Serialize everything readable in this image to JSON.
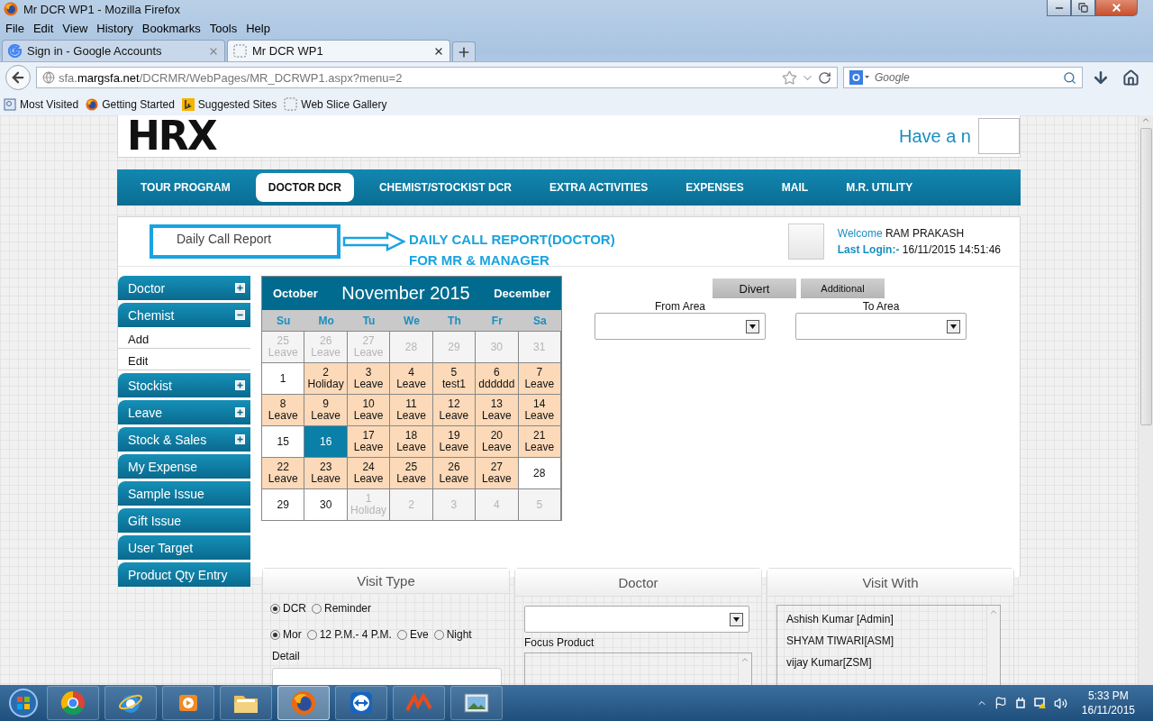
{
  "browser": {
    "title": "Mr DCR WP1 - Mozilla Firefox",
    "menu": [
      "File",
      "Edit",
      "View",
      "History",
      "Bookmarks",
      "Tools",
      "Help"
    ],
    "tabs": [
      {
        "label": "Sign in - Google Accounts",
        "kind": "google",
        "selected": false
      },
      {
        "label": "Mr DCR WP1",
        "kind": "blank",
        "selected": true
      }
    ],
    "url": {
      "pre": "sfa.",
      "host": "margsfa.net",
      "path": "/DCRMR/WebPages/MR_DCRWP1.aspx?menu=2"
    },
    "search_placeholder": "Google",
    "bookmarks": [
      {
        "label": "Most Visited",
        "kind": "page"
      },
      {
        "label": "Getting Started",
        "kind": "firefox"
      },
      {
        "label": "Suggested Sites",
        "kind": "bing"
      },
      {
        "label": "Web Slice Gallery",
        "kind": "blank"
      }
    ]
  },
  "header": {
    "logo": "HRX",
    "marquee": "Have a n"
  },
  "nav": [
    {
      "label": "TOUR PROGRAM",
      "selected": false
    },
    {
      "label": "DOCTOR DCR",
      "selected": true
    },
    {
      "label": "CHEMIST/STOCKIST DCR",
      "selected": false
    },
    {
      "label": "EXTRA ACTIVITIES",
      "selected": false
    },
    {
      "label": "EXPENSES",
      "selected": false
    },
    {
      "label": "MAIL",
      "selected": false
    },
    {
      "label": "M.R. UTILITY",
      "selected": false
    }
  ],
  "report": {
    "select_value": "Daily Call Report",
    "caption": [
      "DAILY CALL REPORT(DOCTOR)",
      "FOR MR & MANAGER"
    ]
  },
  "user": {
    "welcome": "Welcome",
    "name": "RAM PRAKASH",
    "login_label": "Last Login:-",
    "login_time": "16/11/2015 14:51:46"
  },
  "sidebar": [
    {
      "label": "Doctor",
      "kind": "group",
      "expanded": false
    },
    {
      "label": "Chemist",
      "kind": "group",
      "expanded": true,
      "children": [
        {
          "label": "Add"
        },
        {
          "label": "Edit"
        }
      ]
    },
    {
      "label": "Stockist",
      "kind": "group",
      "expanded": false
    },
    {
      "label": "Leave",
      "kind": "group",
      "expanded": false
    },
    {
      "label": "Stock & Sales",
      "kind": "group",
      "expanded": false
    },
    {
      "label": "My Expense",
      "kind": "link"
    },
    {
      "label": "Sample Issue",
      "kind": "link"
    },
    {
      "label": "Gift Issue",
      "kind": "link"
    },
    {
      "label": "User Target",
      "kind": "link"
    },
    {
      "label": "Product Qty Entry",
      "kind": "link"
    }
  ],
  "calendar": {
    "prev": "October",
    "title": "November 2015",
    "next": "December",
    "weekdays": [
      "Su",
      "Mo",
      "Tu",
      "We",
      "Th",
      "Fr",
      "Sa"
    ],
    "weeks": [
      [
        {
          "day": "25",
          "note": "Leave",
          "kind": "muted",
          "selected": false
        },
        {
          "day": "26",
          "note": "Leave",
          "kind": "muted",
          "selected": false
        },
        {
          "day": "27",
          "note": "Leave",
          "kind": "muted",
          "selected": false
        },
        {
          "day": "28",
          "kind": "muted",
          "selected": false
        },
        {
          "day": "29",
          "kind": "muted",
          "selected": false
        },
        {
          "day": "30",
          "kind": "muted",
          "selected": false
        },
        {
          "day": "31",
          "kind": "muted",
          "selected": false
        }
      ],
      [
        {
          "day": "1",
          "kind": "plain",
          "selected": false
        },
        {
          "day": "2",
          "note": "Holiday",
          "kind": "marked",
          "selected": false
        },
        {
          "day": "3",
          "note": "Leave",
          "kind": "marked",
          "selected": false
        },
        {
          "day": "4",
          "note": "Leave",
          "kind": "marked",
          "selected": false
        },
        {
          "day": "5",
          "note": "test1",
          "kind": "marked",
          "selected": false
        },
        {
          "day": "6",
          "note": "dddddd",
          "kind": "marked",
          "selected": false
        },
        {
          "day": "7",
          "note": "Leave",
          "kind": "marked",
          "selected": false
        }
      ],
      [
        {
          "day": "8",
          "note": "Leave",
          "kind": "marked",
          "selected": false
        },
        {
          "day": "9",
          "note": "Leave",
          "kind": "marked",
          "selected": false
        },
        {
          "day": "10",
          "note": "Leave",
          "kind": "marked",
          "selected": false
        },
        {
          "day": "11",
          "note": "Leave",
          "kind": "marked",
          "selected": false
        },
        {
          "day": "12",
          "note": "Leave",
          "kind": "marked",
          "selected": false
        },
        {
          "day": "13",
          "note": "Leave",
          "kind": "marked",
          "selected": false
        },
        {
          "day": "14",
          "note": "Leave",
          "kind": "marked",
          "selected": false
        }
      ],
      [
        {
          "day": "15",
          "kind": "plain",
          "selected": false
        },
        {
          "day": "16",
          "kind": "plain",
          "selected": true
        },
        {
          "day": "17",
          "note": "Leave",
          "kind": "marked",
          "selected": false
        },
        {
          "day": "18",
          "note": "Leave",
          "kind": "marked",
          "selected": false
        },
        {
          "day": "19",
          "note": "Leave",
          "kind": "marked",
          "selected": false
        },
        {
          "day": "20",
          "note": "Leave",
          "kind": "marked",
          "selected": false
        },
        {
          "day": "21",
          "note": "Leave",
          "kind": "marked",
          "selected": false
        }
      ],
      [
        {
          "day": "22",
          "note": "Leave",
          "kind": "marked",
          "selected": false
        },
        {
          "day": "23",
          "note": "Leave",
          "kind": "marked",
          "selected": false
        },
        {
          "day": "24",
          "note": "Leave",
          "kind": "marked",
          "selected": false
        },
        {
          "day": "25",
          "note": "Leave",
          "kind": "marked",
          "selected": false
        },
        {
          "day": "26",
          "note": "Leave",
          "kind": "marked",
          "selected": false
        },
        {
          "day": "27",
          "note": "Leave",
          "kind": "marked",
          "selected": false
        },
        {
          "day": "28",
          "kind": "plain",
          "selected": false
        }
      ],
      [
        {
          "day": "29",
          "kind": "plain",
          "selected": false
        },
        {
          "day": "30",
          "kind": "plain",
          "selected": false
        },
        {
          "day": "1",
          "note": "Holiday",
          "kind": "muted",
          "selected": false
        },
        {
          "day": "2",
          "kind": "muted",
          "selected": false
        },
        {
          "day": "3",
          "kind": "muted",
          "selected": false
        },
        {
          "day": "4",
          "kind": "muted",
          "selected": false
        },
        {
          "day": "5",
          "kind": "muted",
          "selected": false
        }
      ]
    ]
  },
  "divert": {
    "buttons": [
      {
        "label": "Divert",
        "kind": "large"
      },
      {
        "label": "Additional",
        "kind": "small"
      }
    ],
    "from_label": "From Area",
    "to_label": "To Area"
  },
  "visit_type": {
    "title": "Visit Type",
    "option_rows": [
      [
        {
          "label": "DCR",
          "selected": true
        },
        {
          "label": "Reminder",
          "selected": false
        }
      ],
      [
        {
          "label": "Mor",
          "selected": true
        },
        {
          "label": "12 P.M.- 4 P.M.",
          "selected": false
        },
        {
          "label": "Eve",
          "selected": false
        },
        {
          "label": "Night",
          "selected": false
        }
      ]
    ],
    "detail_label": "Detail"
  },
  "doctor": {
    "title": "Doctor",
    "focus_label": "Focus Product"
  },
  "visit_with": {
    "title": "Visit With",
    "people": [
      "Ashish Kumar [Admin]",
      "SHYAM TIWARI[ASM]",
      "vijay Kumar[ZSM]"
    ]
  },
  "taskbar": {
    "apps": [
      {
        "kind": "chrome",
        "active": false
      },
      {
        "kind": "ie",
        "active": false
      },
      {
        "kind": "media",
        "active": false
      },
      {
        "kind": "folder",
        "active": false
      },
      {
        "kind": "firefox",
        "active": true
      },
      {
        "kind": "teamviewer",
        "active": false
      },
      {
        "kind": "marg",
        "active": false
      },
      {
        "kind": "picture",
        "active": false
      }
    ],
    "time": "5:33 PM",
    "date": "16/11/2015"
  }
}
